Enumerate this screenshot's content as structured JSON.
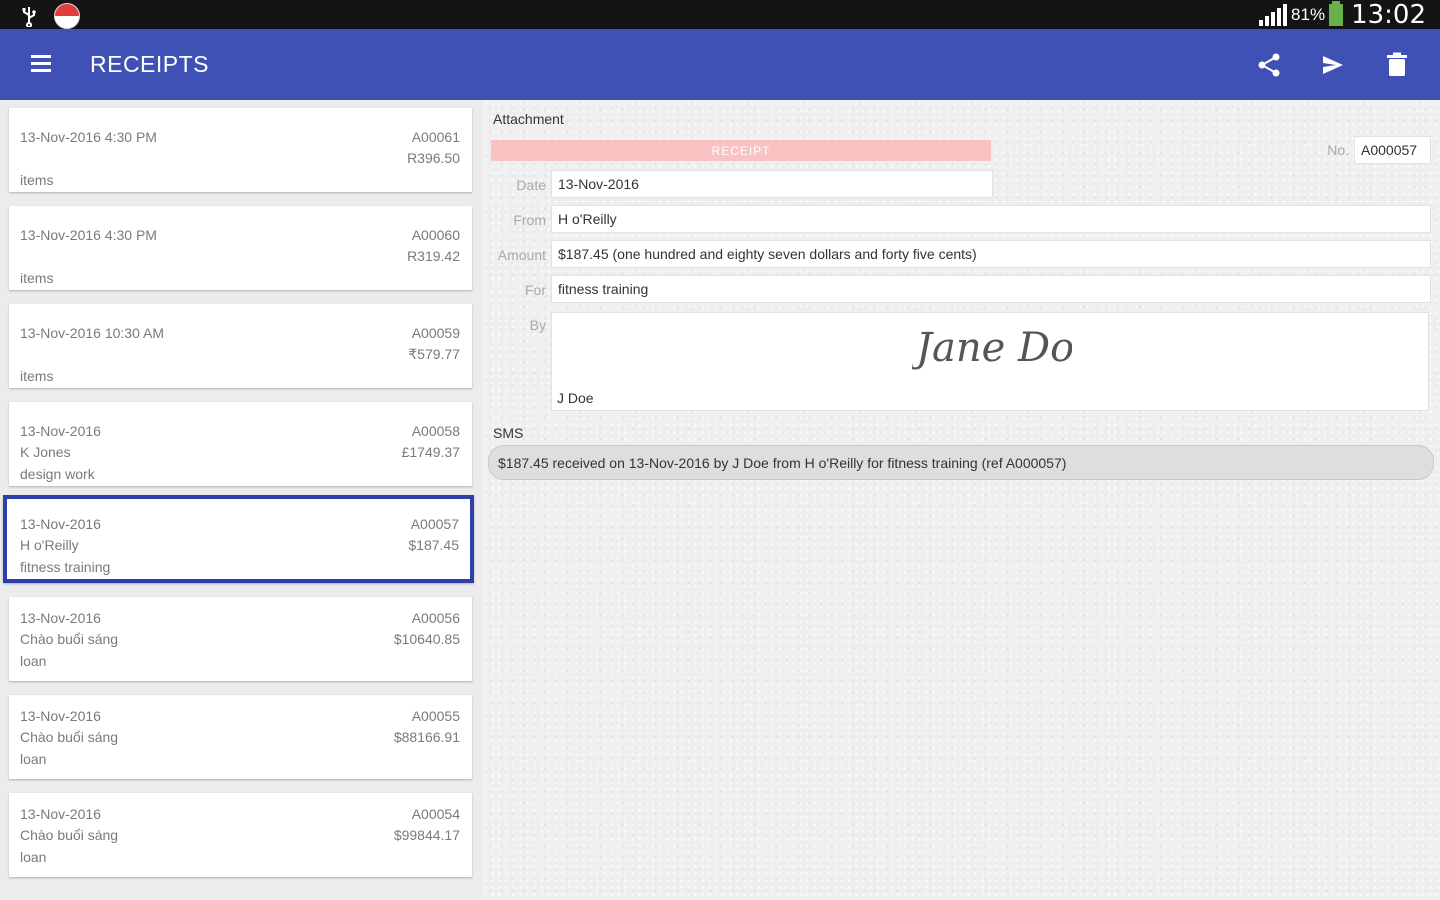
{
  "status_bar": {
    "battery_percent": "81%",
    "time": "13:02"
  },
  "toolbar": {
    "title": "RECEIPTS",
    "actions": [
      "share-icon",
      "send-icon",
      "delete-icon"
    ]
  },
  "receipts": [
    {
      "line1": "13-Nov-2016 4:30 PM",
      "line2": "",
      "line3": "items",
      "number": "A00061",
      "amount": "R396.50"
    },
    {
      "line1": "13-Nov-2016 4:30 PM",
      "line2": "",
      "line3": "items",
      "number": "A00060",
      "amount": "R319.42"
    },
    {
      "line1": "13-Nov-2016 10:30 AM",
      "line2": "",
      "line3": "items",
      "number": "A00059",
      "amount": "₹579.77"
    },
    {
      "line1": "13-Nov-2016",
      "line2": "K Jones",
      "line3": "design work",
      "number": "A00058",
      "amount": "£1749.37"
    },
    {
      "line1": "13-Nov-2016",
      "line2": "H o'Reilly",
      "line3": "fitness training",
      "number": "A00057",
      "amount": "$187.45",
      "selected": true
    },
    {
      "line1": "13-Nov-2016",
      "line2": "Chào buổi sáng",
      "line3": "loan",
      "number": "A00056",
      "amount": "$10640.85"
    },
    {
      "line1": "13-Nov-2016",
      "line2": "Chào buổi sáng",
      "line3": "loan",
      "number": "A00055",
      "amount": "$88166.91"
    },
    {
      "line1": "13-Nov-2016",
      "line2": "Chào buổi sáng",
      "line3": "loan",
      "number": "A00054",
      "amount": "$99844.17"
    }
  ],
  "detail": {
    "attachment_label": "Attachment",
    "banner_text": "RECEIPT",
    "no_label": "No.",
    "no_value": "A000057",
    "date_label": "Date",
    "date_value": "13-Nov-2016",
    "from_label": "From",
    "from_value": "H o'Reilly",
    "amount_label": "Amount",
    "amount_value": "$187.45 (one hundred and eighty seven dollars and forty five cents)",
    "for_label": "For",
    "for_value": "fitness training",
    "by_label": "By",
    "signature_text": "Jane Doe",
    "by_name": "J Doe",
    "sms_label": "SMS",
    "sms_text": "$187.45 received on 13-Nov-2016 by J Doe from H o'Reilly for fitness training (ref A000057)"
  },
  "colors": {
    "toolbar": "#3f51b5",
    "selected_border": "#2e3fa8",
    "banner": "#f9c3c3"
  }
}
